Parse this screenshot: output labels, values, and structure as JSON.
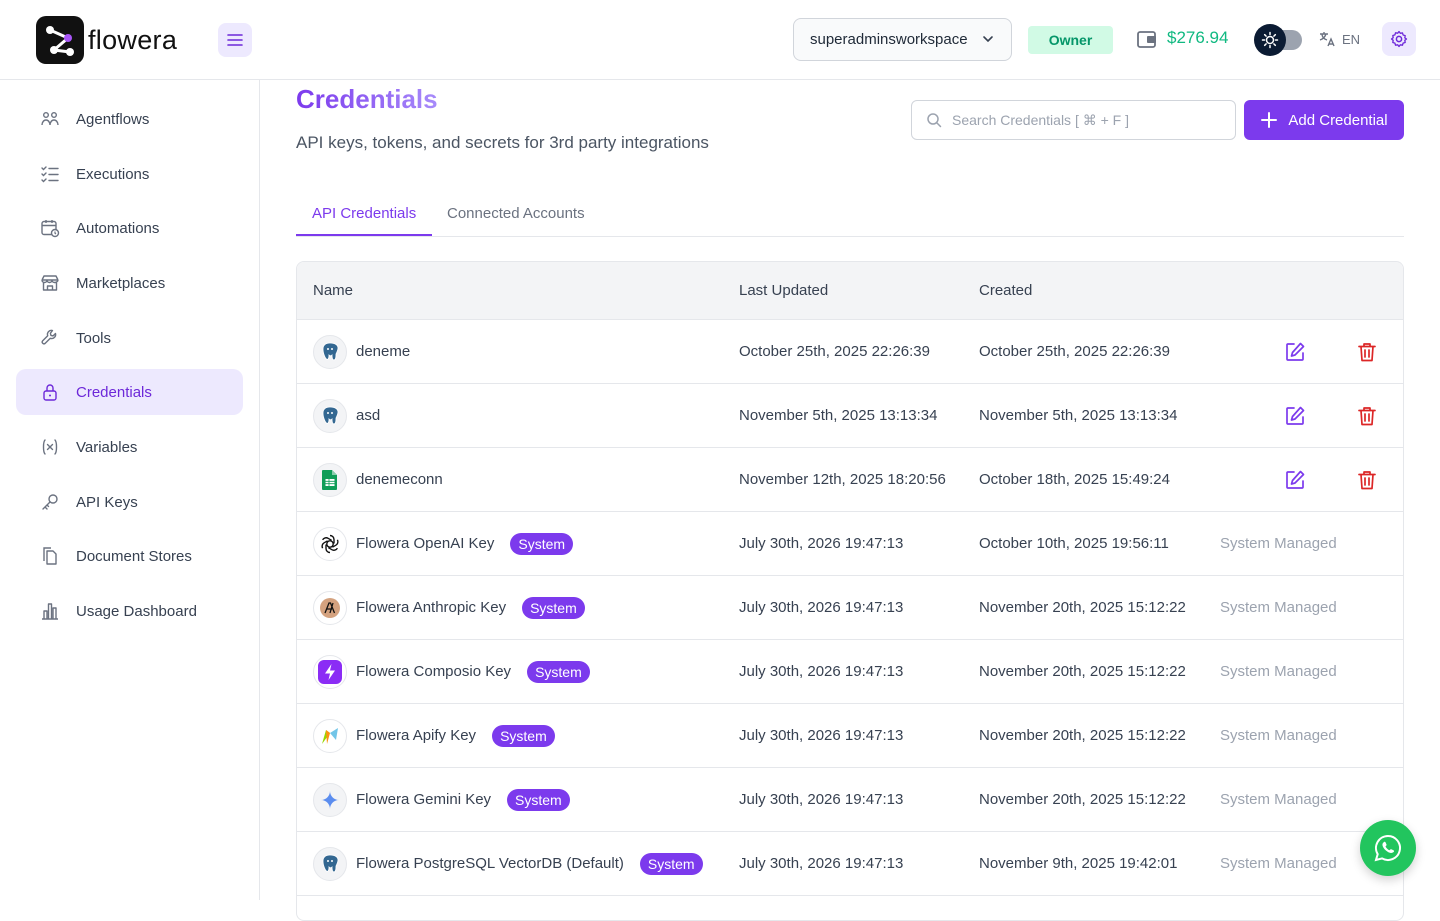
{
  "header": {
    "brand": "flowera",
    "workspace": "superadminsworkspace",
    "role_badge": "Owner",
    "balance": "$276.94",
    "language": "EN",
    "accent_color": "#7c3aed",
    "balance_color": "#10b981"
  },
  "sidebar": {
    "items": [
      {
        "label": "Agentflows",
        "icon": "agentflows-icon"
      },
      {
        "label": "Executions",
        "icon": "checklist-icon"
      },
      {
        "label": "Automations",
        "icon": "calendar-clock-icon"
      },
      {
        "label": "Marketplaces",
        "icon": "store-icon"
      },
      {
        "label": "Tools",
        "icon": "wrench-icon"
      },
      {
        "label": "Credentials",
        "icon": "lock-icon",
        "active": true
      },
      {
        "label": "Variables",
        "icon": "variable-icon"
      },
      {
        "label": "API Keys",
        "icon": "key-icon"
      },
      {
        "label": "Document Stores",
        "icon": "documents-icon"
      },
      {
        "label": "Usage Dashboard",
        "icon": "bar-chart-icon"
      }
    ]
  },
  "main": {
    "title": "Credentials",
    "subtitle": "API keys, tokens, and secrets for 3rd party integrations",
    "search_placeholder": "Search Credentials [ ⌘ + F ]",
    "add_button": "Add Credential",
    "tabs": [
      {
        "label": "API Credentials",
        "active": true
      },
      {
        "label": "Connected Accounts",
        "active": false
      }
    ],
    "table": {
      "columns": [
        "Name",
        "Last Updated",
        "Created"
      ],
      "rows": [
        {
          "name": "deneme",
          "icon": "postgres-icon",
          "updated": "October 25th, 2025 22:26:39",
          "created": "October 25th, 2025 22:26:39",
          "system": false
        },
        {
          "name": "asd",
          "icon": "postgres-icon",
          "updated": "November 5th, 2025 13:13:34",
          "created": "November 5th, 2025 13:13:34",
          "system": false
        },
        {
          "name": "denemeconn",
          "icon": "google-sheets-icon",
          "updated": "November 12th, 2025 18:20:56",
          "created": "October 18th, 2025 15:49:24",
          "system": false
        },
        {
          "name": "Flowera OpenAI Key",
          "icon": "openai-icon",
          "updated": "July 30th, 2026 19:47:13",
          "created": "October 10th, 2025 19:56:11",
          "system": true
        },
        {
          "name": "Flowera Anthropic Key",
          "icon": "anthropic-icon",
          "updated": "July 30th, 2026 19:47:13",
          "created": "November 20th, 2025 15:12:22",
          "system": true
        },
        {
          "name": "Flowera Composio Key",
          "icon": "composio-icon",
          "updated": "July 30th, 2026 19:47:13",
          "created": "November 20th, 2025 15:12:22",
          "system": true
        },
        {
          "name": "Flowera Apify Key",
          "icon": "apify-icon",
          "updated": "July 30th, 2026 19:47:13",
          "created": "November 20th, 2025 15:12:22",
          "system": true
        },
        {
          "name": "Flowera Gemini Key",
          "icon": "gemini-icon",
          "updated": "July 30th, 2026 19:47:13",
          "created": "November 20th, 2025 15:12:22",
          "system": true
        },
        {
          "name": "Flowera PostgreSQL VectorDB (Default)",
          "icon": "postgres-icon",
          "updated": "July 30th, 2026 19:47:13",
          "created": "November 9th, 2025 19:42:01",
          "system": true
        }
      ],
      "system_badge": "System",
      "system_managed": "System Managed"
    }
  }
}
